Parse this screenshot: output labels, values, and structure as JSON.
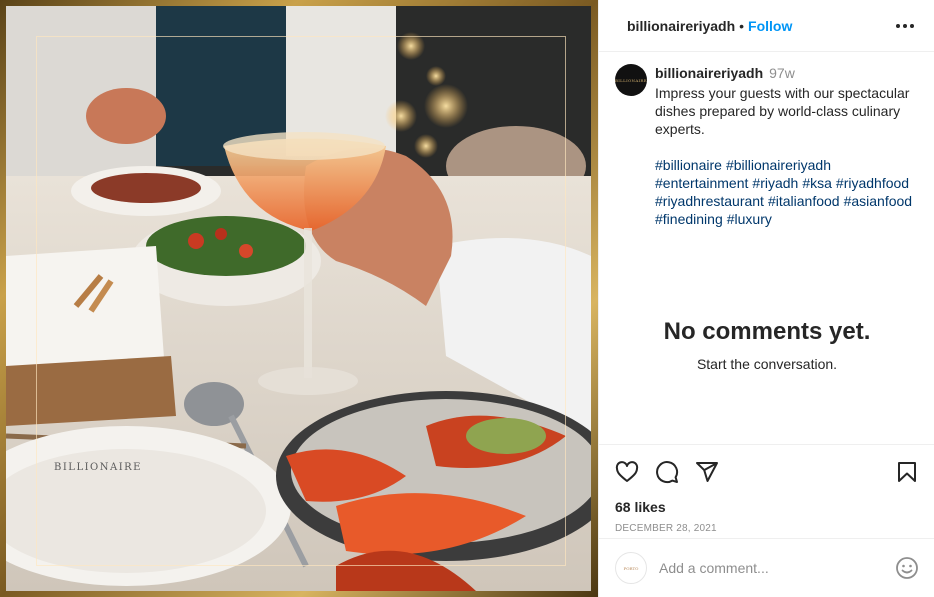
{
  "header": {
    "username": "billionaireriyadh",
    "separator": "•",
    "follow_label": "Follow"
  },
  "photo": {
    "plate_text": "BILLIONAIRE"
  },
  "caption": {
    "avatar_text": "BILLIONAIRE",
    "username": "billionaireriyadh",
    "time": "97w",
    "text": "Impress your guests with our spectacular dishes prepared by world-class culinary experts.",
    "hashtags": [
      "#billionaire",
      "#billionaireriyadh",
      "#entertainment",
      "#riyadh",
      "#ksa",
      "#riyadhfood",
      "#riyadhrestaurant",
      "#italianfood",
      "#asianfood",
      "#finedining",
      "#luxury"
    ]
  },
  "comments": {
    "empty_title": "No comments yet.",
    "empty_subtitle": "Start the conversation."
  },
  "actions": {
    "icons": [
      "heart-icon",
      "comment-icon",
      "share-icon",
      "bookmark-icon"
    ],
    "likes": "68 likes",
    "date": "December 28, 2021"
  },
  "comment_bar": {
    "avatar_text": "PORTO",
    "placeholder": "Add a comment...",
    "icon": "emoji-icon"
  },
  "colors": {
    "accent": "#0095f6",
    "hashtag": "#00376b",
    "muted": "#8e8e8e",
    "text": "#262626",
    "frame_gold": "#c9a14a"
  }
}
